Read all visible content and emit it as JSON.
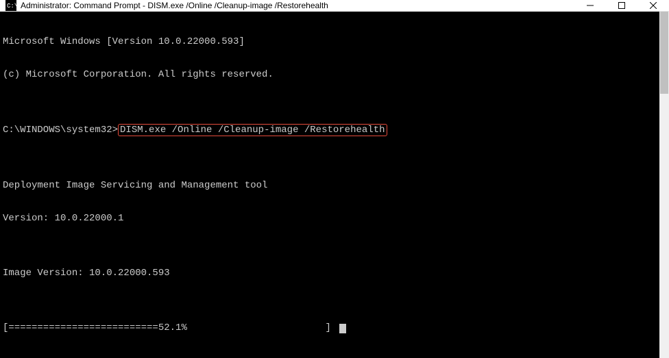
{
  "titlebar": {
    "title": "Administrator: Command Prompt - DISM.exe  /Online /Cleanup-image /Restorehealth"
  },
  "terminal": {
    "line1": "Microsoft Windows [Version 10.0.22000.593]",
    "line2": "(c) Microsoft Corporation. All rights reserved.",
    "blank1": "",
    "prompt": "C:\\WINDOWS\\system32>",
    "command": "DISM.exe /Online /Cleanup-image /Restorehealth",
    "blank2": "",
    "tool_line1": "Deployment Image Servicing and Management tool",
    "tool_line2": "Version: 10.0.22000.1",
    "blank3": "",
    "image_version": "Image Version: 10.0.22000.593",
    "blank4": "",
    "progress_left": "[==========================52.1%",
    "progress_right": "] "
  }
}
